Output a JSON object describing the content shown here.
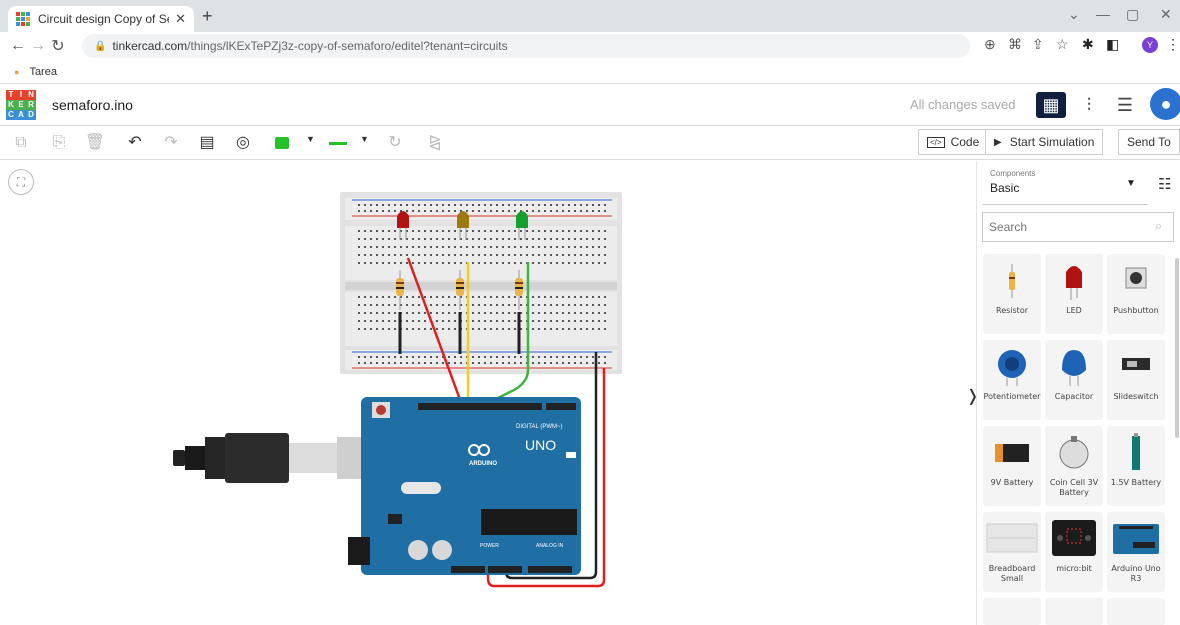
{
  "browser": {
    "tab_title": "Circuit design Copy of Semáforo",
    "url_host": "tinkercad.com",
    "url_path": "/things/lKExTePZj3z-copy-of-semaforo/editel?tenant=circuits",
    "bookmark": "Tarea",
    "profile_letter": "Y"
  },
  "header": {
    "logo_letters": [
      "T",
      "I",
      "N",
      "K",
      "E",
      "R",
      "C",
      "A",
      "D"
    ],
    "design_name": "semaforo.ino",
    "status": "All changes saved"
  },
  "toolbar": {
    "code_label": "Code",
    "start_sim_label": "Start Simulation",
    "send_to_label": "Send To",
    "color_accent": "#26c128"
  },
  "components": {
    "select_label": "Components",
    "select_value": "Basic",
    "search_placeholder": "Search",
    "items": [
      {
        "label": "Resistor",
        "icon": "resistor-icon"
      },
      {
        "label": "LED",
        "icon": "led-icon"
      },
      {
        "label": "Pushbutton",
        "icon": "pushbutton-icon"
      },
      {
        "label": "Potentiometer",
        "icon": "potentiometer-icon"
      },
      {
        "label": "Capacitor",
        "icon": "capacitor-icon"
      },
      {
        "label": "Slideswitch",
        "icon": "slideswitch-icon"
      },
      {
        "label": "9V Battery",
        "icon": "battery-9v-icon"
      },
      {
        "label": "Coin Cell 3V Battery",
        "icon": "coin-cell-icon"
      },
      {
        "label": "1.5V Battery",
        "icon": "battery-aa-icon"
      },
      {
        "label": "Breadboard Small",
        "icon": "breadboard-icon"
      },
      {
        "label": "micro:bit",
        "icon": "microbit-icon"
      },
      {
        "label": "Arduino Uno R3",
        "icon": "arduino-icon"
      }
    ]
  },
  "board": {
    "digital_label": "DIGITAL (PWM~)",
    "brand": "ARDUINO",
    "model": "UNO",
    "power_label": "POWER",
    "analog_label": "ANALOG IN",
    "led_colors": [
      "#b11212",
      "#9c7a0e",
      "#14a02c"
    ],
    "wire_colors": {
      "red": "#e02020",
      "yellow": "#f0d020",
      "green": "#3fb53f",
      "black": "#222222"
    }
  }
}
